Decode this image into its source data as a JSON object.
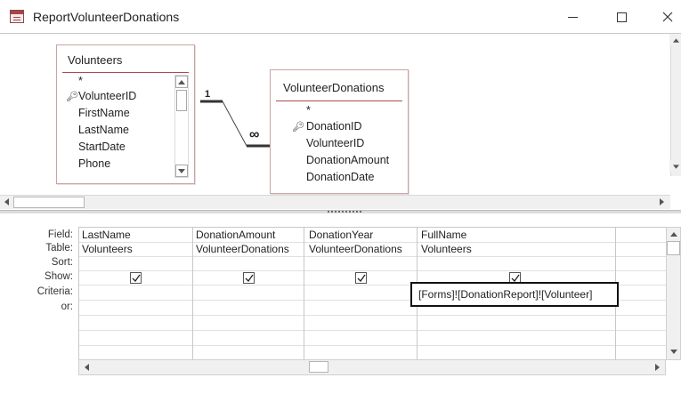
{
  "window": {
    "title": "ReportVolunteerDonations",
    "minimize": "—",
    "maximize": "☐",
    "close": "✕"
  },
  "tables": [
    {
      "name": "Volunteers",
      "fields": [
        "*",
        "VolunteerID",
        "FirstName",
        "LastName",
        "StartDate",
        "Phone"
      ],
      "key_field": "VolunteerID"
    },
    {
      "name": "VolunteerDonations",
      "fields": [
        "*",
        "DonationID",
        "VolunteerID",
        "DonationAmount",
        "DonationDate"
      ],
      "key_field": "DonationID"
    }
  ],
  "relationship": {
    "one_label": "1",
    "many_label": "∞"
  },
  "grid": {
    "row_labels": [
      "Field:",
      "Table:",
      "Sort:",
      "Show:",
      "Criteria:",
      "or:"
    ],
    "columns": [
      {
        "field": "LastName",
        "table": "Volunteers",
        "sort": "",
        "show": true,
        "criteria": ""
      },
      {
        "field": "DonationAmount",
        "table": "VolunteerDonations",
        "sort": "",
        "show": true,
        "criteria": ""
      },
      {
        "field": "DonationYear",
        "table": "VolunteerDonations",
        "sort": "",
        "show": true,
        "criteria": ""
      },
      {
        "field": "FullName",
        "table": "Volunteers",
        "sort": "",
        "show": true,
        "criteria": "[Forms]![DonationReport]![Volunteer]"
      }
    ]
  },
  "icons": {
    "app": "query-icon",
    "key": "primary-key-icon",
    "check": "checkmark-icon"
  }
}
